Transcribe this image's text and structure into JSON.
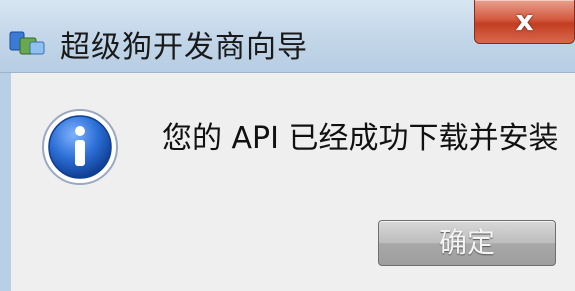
{
  "window": {
    "title": "超级狗开发商向导",
    "close_glyph": "x"
  },
  "dialog": {
    "icon": "info-icon",
    "message": "您的 API 已经成功下载并安装",
    "ok_label": "确定"
  },
  "colors": {
    "titlebar": "#c5d8ea",
    "close_button": "#c33d22",
    "body_background": "#efefef",
    "info_icon_blue": "#1f5fbf"
  }
}
